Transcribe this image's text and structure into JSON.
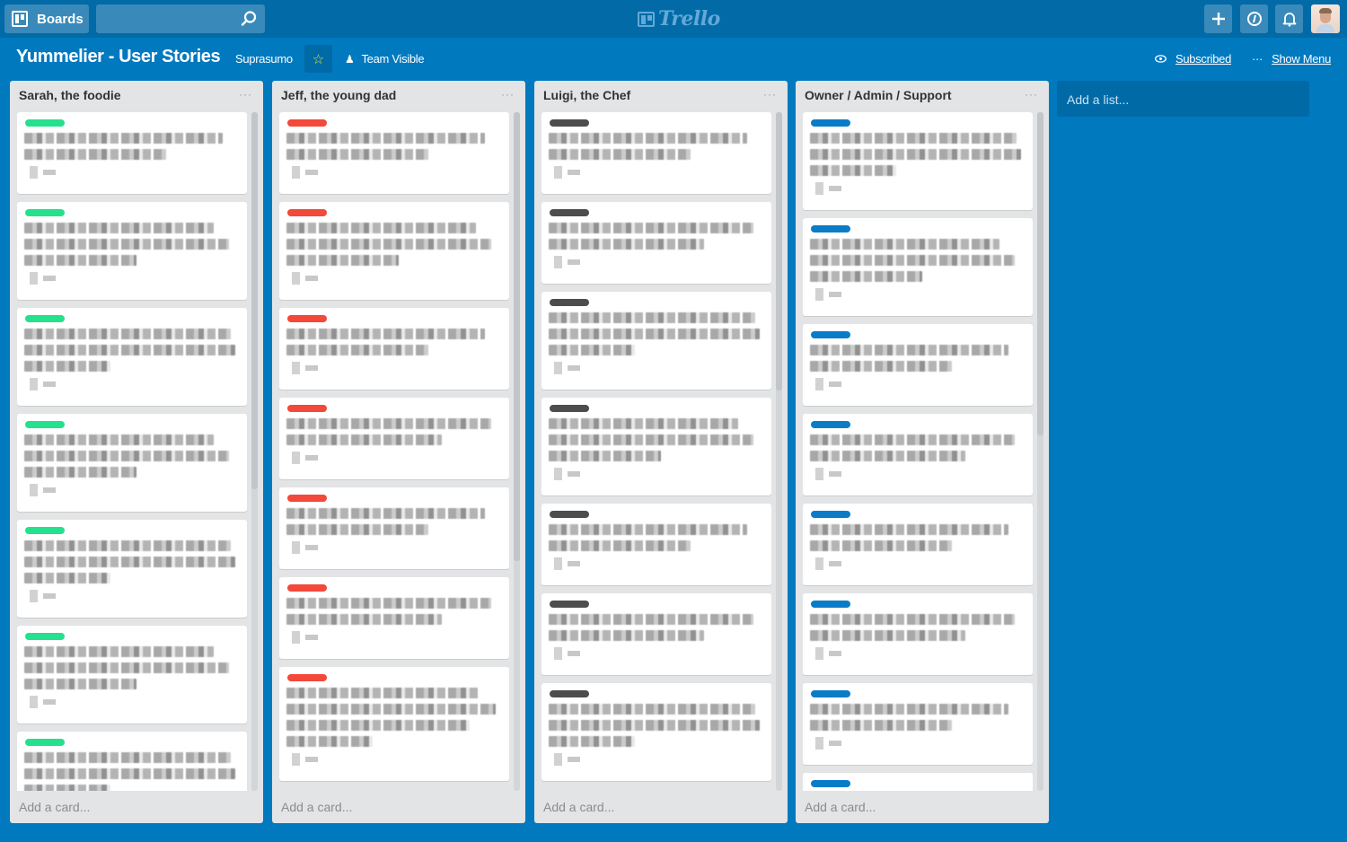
{
  "header": {
    "boards_label": "Boards",
    "search_placeholder": "",
    "logo_text": "Trello",
    "icons": [
      "boards-icon",
      "search-icon",
      "add-icon",
      "info-icon",
      "notifications-bell-icon"
    ],
    "avatar_alt": "user avatar"
  },
  "board": {
    "title": "Yummelier - User Stories",
    "organization": "Suprasumo",
    "starred": true,
    "visibility": "Team Visible",
    "subscribed": "Subscribed",
    "show_menu": "Show Menu",
    "menu_glyph": "···"
  },
  "colors": {
    "background": "#0079bf",
    "header": "#026aa7",
    "list": "#e2e4e6",
    "label_green": "#25e08c",
    "label_red": "#f2493b",
    "label_dark": "#4d4d4d",
    "label_blue": "#0a7cc7"
  },
  "lists": [
    {
      "name": "Sarah, the foodie",
      "menu": "···",
      "add_card": "Add a card...",
      "label_color": "#25e08c",
      "cards": [
        {
          "label": "green",
          "lines": 2,
          "text": "[blurred]"
        },
        {
          "label": "green",
          "lines": 3,
          "text": "[blurred]"
        },
        {
          "label": "green",
          "lines": 3,
          "text": "[blurred]"
        },
        {
          "label": "green",
          "lines": 3,
          "text": "[blurred]"
        },
        {
          "label": "green",
          "lines": 3,
          "text": "[blurred]"
        },
        {
          "label": "green",
          "lines": 3,
          "text": "[blurred]"
        },
        {
          "label": "green",
          "lines": 3,
          "text": "[blurred]"
        }
      ]
    },
    {
      "name": "Jeff, the young dad",
      "menu": "···",
      "add_card": "Add a card...",
      "label_color": "#f2493b",
      "cards": [
        {
          "label": "red",
          "lines": 2,
          "text": "[blurred]"
        },
        {
          "label": "red",
          "lines": 3,
          "text": "[blurred]"
        },
        {
          "label": "red",
          "lines": 2,
          "text": "[blurred]"
        },
        {
          "label": "red",
          "lines": 2,
          "text": "[blurred]"
        },
        {
          "label": "red",
          "lines": 2,
          "text": "[blurred]"
        },
        {
          "label": "red",
          "lines": 2,
          "text": "[blurred]"
        },
        {
          "label": "red",
          "lines": 4,
          "text": "[blurred]"
        }
      ]
    },
    {
      "name": "Luigi, the Chef",
      "menu": "···",
      "add_card": "Add a card...",
      "label_color": "#4d4d4d",
      "cards": [
        {
          "label": "dark",
          "lines": 2,
          "text": "[blurred]"
        },
        {
          "label": "dark",
          "lines": 2,
          "text": "[blurred]"
        },
        {
          "label": "dark",
          "lines": 3,
          "text": "[blurred]"
        },
        {
          "label": "dark",
          "lines": 3,
          "text": "[blurred]"
        },
        {
          "label": "dark",
          "lines": 2,
          "text": "[blurred]"
        },
        {
          "label": "dark",
          "lines": 2,
          "text": "[blurred]"
        },
        {
          "label": "dark",
          "lines": 3,
          "text": "[blurred]"
        }
      ]
    },
    {
      "name": "Owner / Admin / Support",
      "menu": "···",
      "add_card": "Add a card...",
      "label_color": "#0a7cc7",
      "cards": [
        {
          "label": "blue",
          "lines": 3,
          "text": "[blurred]"
        },
        {
          "label": "blue",
          "lines": 3,
          "text": "[blurred]"
        },
        {
          "label": "blue",
          "lines": 2,
          "text": "[blurred]"
        },
        {
          "label": "blue",
          "lines": 2,
          "text": "[blurred]"
        },
        {
          "label": "blue",
          "lines": 2,
          "text": "[blurred]"
        },
        {
          "label": "blue",
          "lines": 2,
          "text": "[blurred]"
        },
        {
          "label": "blue",
          "lines": 2,
          "text": "[blurred]"
        },
        {
          "label": "blue",
          "lines": 0,
          "text": "[blurred]"
        }
      ]
    }
  ],
  "add_list": "Add a list..."
}
